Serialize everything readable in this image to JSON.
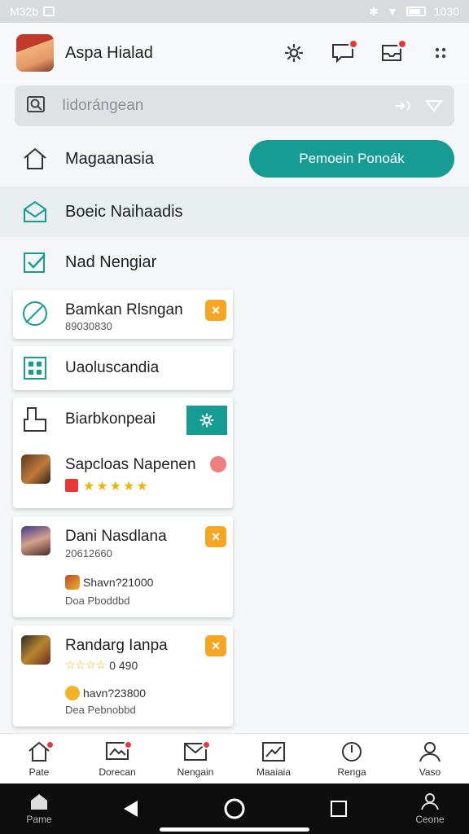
{
  "status_bar": {
    "time_left": "M32b",
    "time_right": "1030"
  },
  "header": {
    "title": "Aspa Hialad"
  },
  "search": {
    "placeholder": "Iidorángean"
  },
  "rows": {
    "home_label": "Magaanasia",
    "primary_button": "Pemoein Ponoák",
    "active_label": "Boeic Naihaadis",
    "check_label": "Nad Nengiar"
  },
  "cards": [
    {
      "title": "Bamkan Rlsngan",
      "subtitle": "89030830"
    },
    {
      "title": "Uaoluscandia"
    },
    {
      "title": "Biarbkonpeai",
      "item_title": "Sapcloas Napenen",
      "rating": 5
    },
    {
      "title": "Dani Nasdlana",
      "subtitle": "20612660",
      "mini_text": "Shavn?21000",
      "footer": "Doa Pboddbd"
    },
    {
      "title": "Randarg Ianpa",
      "rating_text": "0 490",
      "mini_text": "havn?23800",
      "footer": "Dea Pebnobbd"
    }
  ],
  "bottom_nav": [
    {
      "label": "Pate",
      "icon": "home-icon",
      "badge": true
    },
    {
      "label": "Dorecan",
      "icon": "image-icon",
      "badge": true
    },
    {
      "label": "Nengain",
      "icon": "mail-icon",
      "badge": true
    },
    {
      "label": "Maaiaia",
      "icon": "chart-icon",
      "badge": false
    },
    {
      "label": "Renga",
      "icon": "clock-icon",
      "badge": false
    },
    {
      "label": "Vaso",
      "icon": "profile-icon",
      "badge": false
    }
  ],
  "system_nav": {
    "home_label": "Pame",
    "right_label": "Ceone"
  },
  "colors": {
    "accent": "#169c93",
    "badge": "#e53935",
    "close": "#f5a623",
    "star": "#f5b301"
  }
}
